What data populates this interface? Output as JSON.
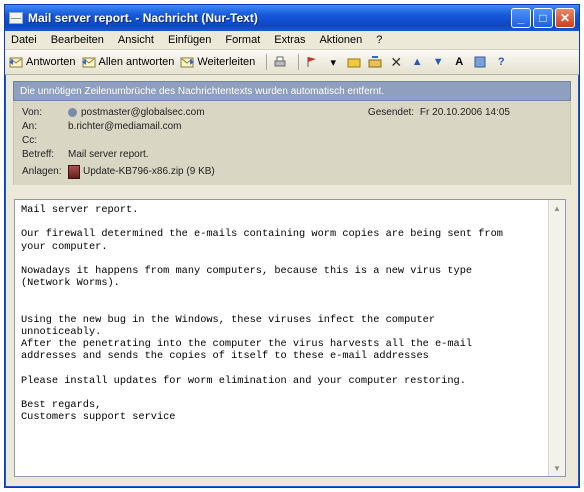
{
  "window": {
    "title": "Mail server report. - Nachricht (Nur-Text)"
  },
  "menu": [
    "Datei",
    "Bearbeiten",
    "Ansicht",
    "Einfügen",
    "Format",
    "Extras",
    "Aktionen",
    "?"
  ],
  "toolbar": {
    "reply": "Antworten",
    "reply_all": "Allen antworten",
    "forward": "Weiterleiten"
  },
  "infobar": {
    "text": "Die unnötigen Zeilenumbrüche des Nachrichtentexts wurden automatisch entfernt."
  },
  "headers": {
    "from_label": "Von:",
    "from_value": "postmaster@globalsec.com",
    "to_label": "An:",
    "to_value": "b.richter@mediamail.com",
    "cc_label": "Cc:",
    "cc_value": "",
    "subject_label": "Betreff:",
    "subject_value": "Mail server report.",
    "sent_label": "Gesendet:",
    "sent_value": "Fr 20.10.2006 14:05",
    "attach_label": "Anlagen:",
    "attach_value": "Update-KB796-x86.zip (9 KB)"
  },
  "body": {
    "text": "Mail server report.\n\nOur firewall determined the e-mails containing worm copies are being sent from\nyour computer.\n\nNowadays it happens from many computers, because this is a new virus type\n(Network Worms).\n\n\nUsing the new bug in the Windows, these viruses infect the computer\nunnoticeably.\nAfter the penetrating into the computer the virus harvests all the e-mail\naddresses and sends the copies of itself to these e-mail addresses\n\nPlease install updates for worm elimination and your computer restoring.\n\nBest regards,\nCustomers support service"
  },
  "colors": {
    "titlebar": "#0c48c7",
    "infobar": "#8e9fc0",
    "header_bg": "#d9d6c4"
  }
}
